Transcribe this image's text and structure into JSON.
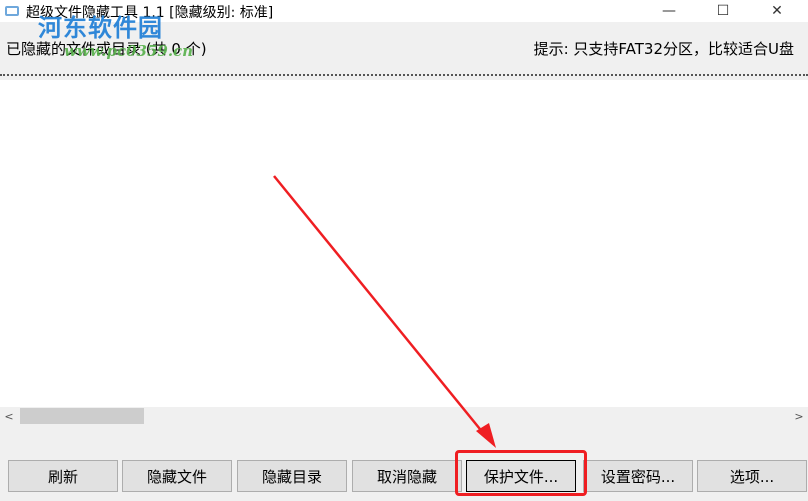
{
  "window": {
    "title": "超级文件隐藏工具 1.1  [隐藏级别: 标准]",
    "min_glyph": "—",
    "max_glyph": "☐",
    "close_glyph": "✕"
  },
  "watermark": {
    "logo_text": "河东软件园",
    "url_text": "www.pc0359.cn"
  },
  "info": {
    "hidden_list_label": "已隐藏的文件或目录 (共 0 个)",
    "hint": "提示: 只支持FAT32分区，比较适合U盘"
  },
  "scrollbar": {
    "left_arrow": "<",
    "right_arrow": ">"
  },
  "buttons": {
    "refresh": "刷新",
    "hide_file": "隐藏文件",
    "hide_dir": "隐藏目录",
    "unhide": "取消隐藏",
    "protect_file": "保护文件...",
    "set_password": "设置密码...",
    "options": "选项..."
  },
  "colors": {
    "annotation": "#ef1e22",
    "watermark_blue": "#1f7fd6",
    "watermark_green": "#56b04a"
  },
  "icons": {
    "app": "app-icon",
    "annotation_arrow": "red-arrow-icon"
  }
}
